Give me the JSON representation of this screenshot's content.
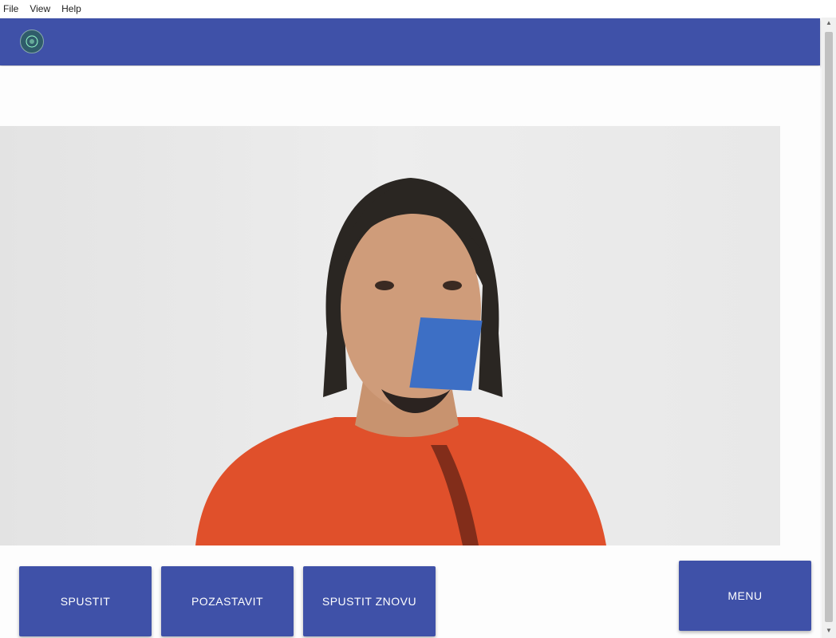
{
  "menu": {
    "file": "File",
    "view": "View",
    "help": "Help"
  },
  "header": {
    "logo_icon": "app-logo-icon",
    "color": "#3f51a8"
  },
  "video": {
    "overlay_color": "#3d6fc5"
  },
  "controls": {
    "start": "SPUSTIT",
    "pause": "POZASTAVIT",
    "restart": "SPUSTIT ZNOVU",
    "menu": "MENU"
  }
}
